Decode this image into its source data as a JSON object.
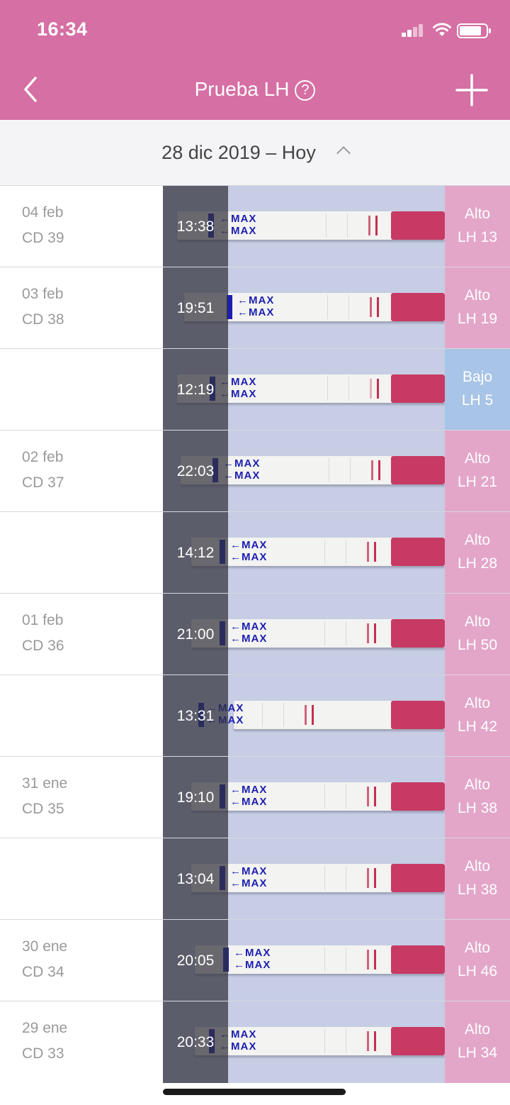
{
  "status_bar": {
    "time": "16:34"
  },
  "nav": {
    "title": "Prueba LH",
    "help": "?",
    "back_icon": "chevron-left-icon",
    "add_icon": "plus-icon"
  },
  "date_range": {
    "label": "28 dic 2019 – Hoy",
    "icon": "chevron-up-icon"
  },
  "colors": {
    "header": "#d66fa3",
    "high": "#e3a6c9",
    "low": "#a8c4e6"
  },
  "rows": [
    {
      "date": "04 feb",
      "cycle_day": "CD 39",
      "time": "13:38",
      "level": "Alto",
      "lh": "LH 13"
    },
    {
      "date": "03 feb",
      "cycle_day": "CD 38",
      "time": "19:51",
      "level": "Alto",
      "lh": "LH 19"
    },
    {
      "date": "",
      "cycle_day": "",
      "time": "12:19",
      "level": "Bajo",
      "lh": "LH 5"
    },
    {
      "date": "02 feb",
      "cycle_day": "CD 37",
      "time": "22:03",
      "level": "Alto",
      "lh": "LH 21"
    },
    {
      "date": "",
      "cycle_day": "",
      "time": "14:12",
      "level": "Alto",
      "lh": "LH 28"
    },
    {
      "date": "01 feb",
      "cycle_day": "CD 36",
      "time": "21:00",
      "level": "Alto",
      "lh": "LH 50"
    },
    {
      "date": "",
      "cycle_day": "",
      "time": "13:31",
      "level": "Alto",
      "lh": "LH 42"
    },
    {
      "date": "31 ene",
      "cycle_day": "CD 35",
      "time": "19:10",
      "level": "Alto",
      "lh": "LH 38"
    },
    {
      "date": "",
      "cycle_day": "",
      "time": "13:04",
      "level": "Alto",
      "lh": "LH 38"
    },
    {
      "date": "30 ene",
      "cycle_day": "CD 34",
      "time": "20:05",
      "level": "Alto",
      "lh": "LH 46"
    },
    {
      "date": "29 ene",
      "cycle_day": "CD 33",
      "time": "20:33",
      "level": "Alto",
      "lh": "LH 34"
    }
  ],
  "strip": {
    "max_label": "MAX"
  }
}
